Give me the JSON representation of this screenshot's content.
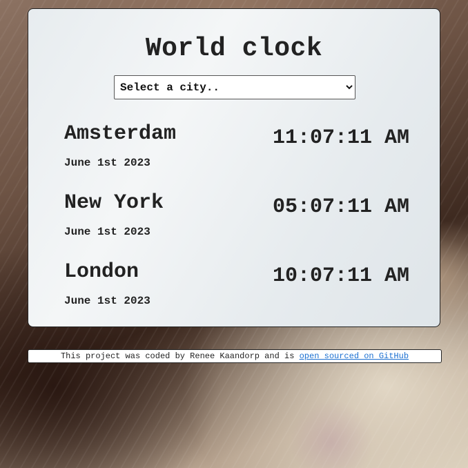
{
  "app": {
    "title": "World clock"
  },
  "city_select": {
    "selected": "Select a city.."
  },
  "cities": [
    {
      "name": "Amsterdam",
      "date": "June 1st 2023",
      "time": "11:07:11 AM"
    },
    {
      "name": "New York",
      "date": "June 1st 2023",
      "time": "05:07:11 AM"
    },
    {
      "name": "London",
      "date": "June 1st 2023",
      "time": "10:07:11 AM"
    }
  ],
  "footer": {
    "text": "This project was coded by Renee Kaandorp and is",
    "link_label": "open sourced on GitHub"
  }
}
